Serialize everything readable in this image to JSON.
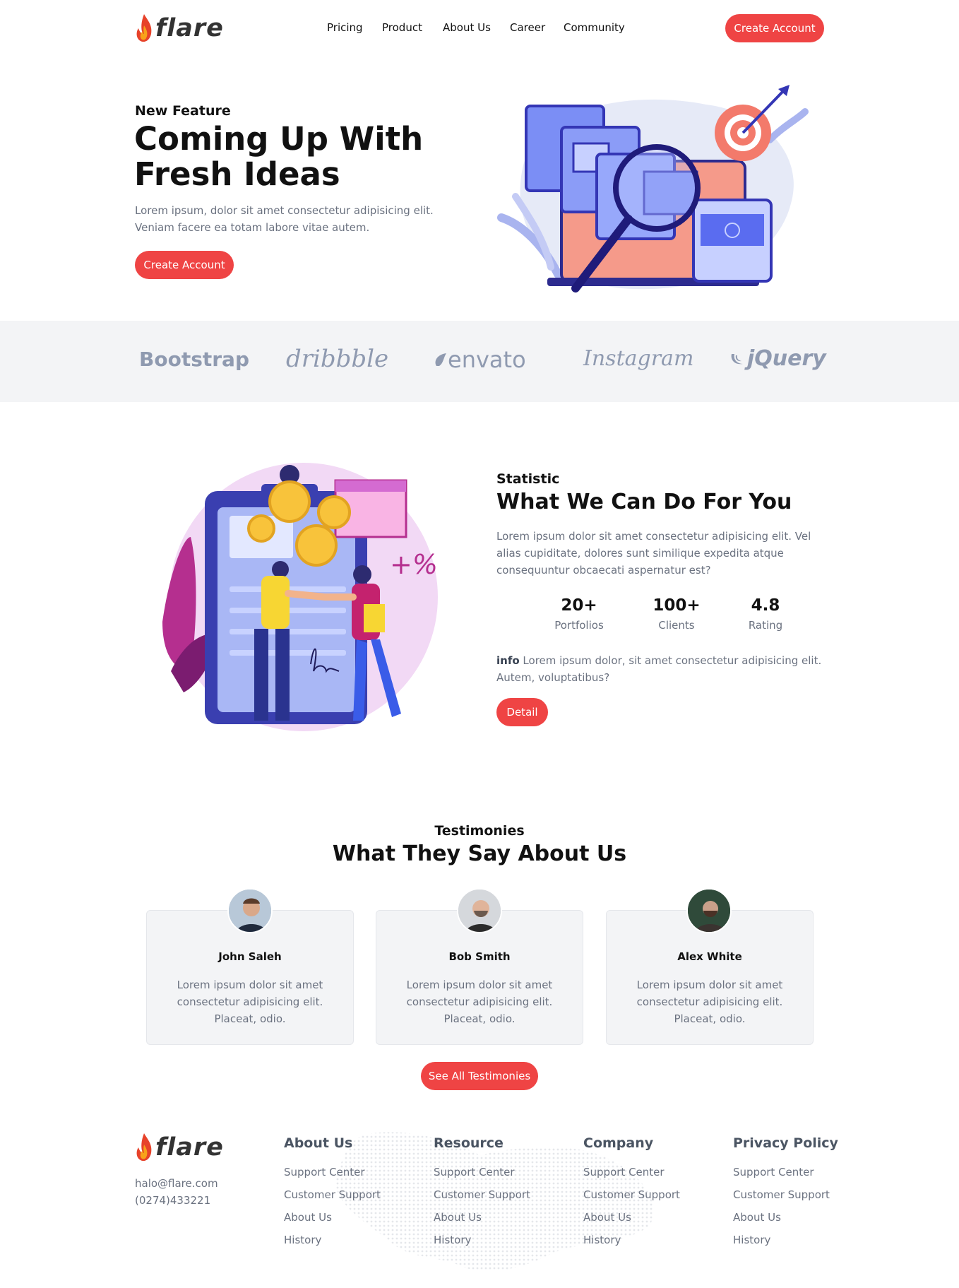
{
  "header": {
    "logo_text": "flare",
    "nav": [
      "Pricing",
      "Product",
      "About Us",
      "Career",
      "Community"
    ],
    "cta": "Create Account"
  },
  "hero": {
    "eyebrow": "New Feature",
    "title_line1": "Coming Up With",
    "title_line2": "Fresh Ideas",
    "description": "Lorem ipsum, dolor sit amet consectetur adipisicing elit. Veniam facere ea totam labore vitae autem.",
    "cta": "Create Account"
  },
  "brands": [
    "Bootstrap",
    "dribbble",
    "envato",
    "Instagram",
    "jQuery"
  ],
  "statistic": {
    "eyebrow": "Statistic",
    "title": "What We Can Do For You",
    "description": "Lorem ipsum dolor sit amet consectetur adipisicing elit. Vel alias cupiditate, dolores sunt similique expedita atque consequuntur obcaecati aspernatur est?",
    "stats": [
      {
        "value": "20+",
        "label": "Portfolios"
      },
      {
        "value": "100+",
        "label": "Clients"
      },
      {
        "value": "4.8",
        "label": "Rating"
      }
    ],
    "info_label": "info",
    "info_text": " Lorem ipsum dolor, sit amet consectetur adipisicing elit. Autem, voluptatibus?",
    "cta": "Detail",
    "illustration_text": "+%"
  },
  "testimonies": {
    "eyebrow": "Testimonies",
    "title": "What They Say About Us",
    "items": [
      {
        "name": "John Saleh",
        "text": "Lorem ipsum dolor sit amet consectetur adipisicing elit. Placeat, odio."
      },
      {
        "name": "Bob Smith",
        "text": "Lorem ipsum dolor sit amet consectetur adipisicing elit. Placeat, odio."
      },
      {
        "name": "Alex White",
        "text": "Lorem ipsum dolor sit amet consectetur adipisicing elit. Placeat, odio."
      }
    ],
    "cta": "See All Testimonies"
  },
  "footer": {
    "logo_text": "flare",
    "email": "halo@flare.com",
    "phone": "(0274)433221",
    "columns": [
      {
        "title": "About Us",
        "links": [
          "Support Center",
          "Customer Support",
          "About Us",
          "History"
        ]
      },
      {
        "title": "Resource",
        "links": [
          "Support Center",
          "Customer Support",
          "About Us",
          "History"
        ]
      },
      {
        "title": "Company",
        "links": [
          "Support Center",
          "Customer Support",
          "About Us",
          "History"
        ]
      },
      {
        "title": "Privacy Policy",
        "links": [
          "Support Center",
          "Customer Support",
          "About Us",
          "History"
        ]
      }
    ]
  },
  "colors": {
    "accent": "#ef4444",
    "brand_gray": "#8f9ab0",
    "band_bg": "#f3f4f6"
  },
  "icons": [
    "flame-icon"
  ]
}
